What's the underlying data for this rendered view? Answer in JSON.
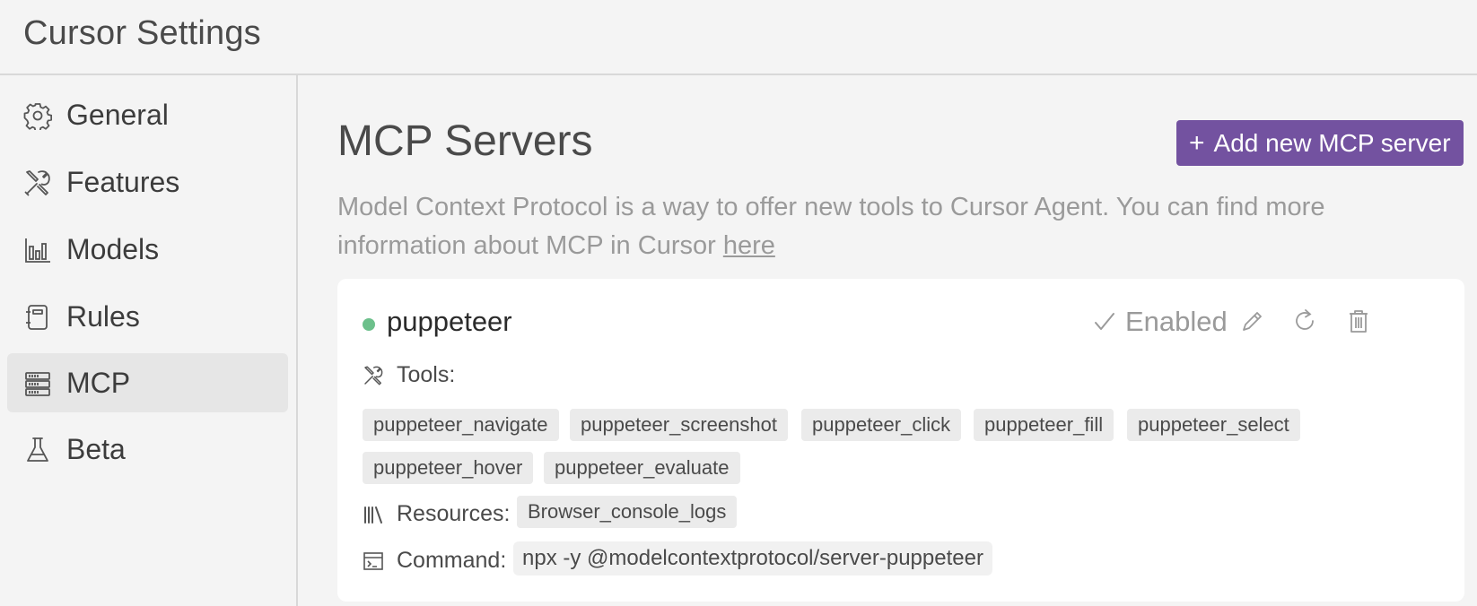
{
  "window": {
    "title": "Cursor Settings"
  },
  "sidebar": {
    "items": [
      {
        "label": "General",
        "icon": "gear-icon"
      },
      {
        "label": "Features",
        "icon": "tools-icon"
      },
      {
        "label": "Models",
        "icon": "bar-chart-icon"
      },
      {
        "label": "Rules",
        "icon": "notebook-icon"
      },
      {
        "label": "MCP",
        "icon": "server-rack-icon",
        "active": true
      },
      {
        "label": "Beta",
        "icon": "flask-icon"
      }
    ]
  },
  "main": {
    "title": "MCP Servers",
    "add_button": {
      "icon": "+",
      "label": "Add new MCP server"
    },
    "description": {
      "text": "Model Context Protocol is a way to offer new tools to Cursor Agent. You can find more information about MCP in Cursor ",
      "link": "here"
    },
    "server": {
      "name": "puppeteer",
      "status_color": "#6cc08b",
      "enabled_label": "Enabled",
      "tools_label": "Tools:",
      "tools": [
        "puppeteer_navigate",
        "puppeteer_screenshot",
        "puppeteer_click",
        "puppeteer_fill",
        "puppeteer_select",
        "puppeteer_hover",
        "puppeteer_evaluate"
      ],
      "resources_label": "Resources:",
      "resources": [
        "Browser_console_logs"
      ],
      "command_label": "Command:",
      "command": "npx -y @modelcontextprotocol/server-puppeteer"
    }
  },
  "colors": {
    "accent": "#7352a0",
    "status_ok": "#6cc08b"
  }
}
